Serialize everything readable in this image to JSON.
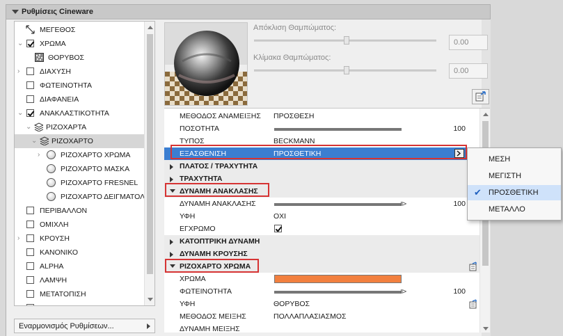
{
  "header": {
    "title": "Ρυθμίσεις Cineware"
  },
  "tree": {
    "items": [
      {
        "label": "ΜΕΓΕΘΟΣ"
      },
      {
        "label": "ΧΡΩΜΑ"
      },
      {
        "label": "ΘΟΡΥΒΟΣ"
      },
      {
        "label": "ΔΙΑΧΥΣΗ"
      },
      {
        "label": "ΦΩΤΕΙΝΟΤΗΤΑ"
      },
      {
        "label": "ΔΙΑΦΑΝΕΙΑ"
      },
      {
        "label": "ΑΝΑΚΛΑΣΤΙΚΟΤΗΤΑ"
      },
      {
        "label": "ΡΙΖΟΧΑΡΤΑ"
      },
      {
        "label": "ΡΙΖΟΧΑΡΤΟ"
      },
      {
        "label": "ΡΙΖΟΧΑΡΤΟ ΧΡΩΜΑ"
      },
      {
        "label": "ΡΙΖΟΧΑΡΤΟ ΜΑΣΚΑ"
      },
      {
        "label": "ΡΙΖΟΧΑΡΤΟ FRESNEL"
      },
      {
        "label": "ΡΙΖΟΧΑΡΤΟ ΔΕΙΓΜΑΤΟΛ"
      },
      {
        "label": "ΠΕΡΙΒΑΛΛΟΝ"
      },
      {
        "label": "ΟΜΙΧΛΗ"
      },
      {
        "label": "ΚΡΟΥΣΗ"
      },
      {
        "label": "ΚΑΝΟΝΙΚΟ"
      },
      {
        "label": "ALPHA"
      },
      {
        "label": "ΛΑΜΨΗ"
      },
      {
        "label": "ΜΕΤΑΤΟΠΙΣΗ"
      }
    ]
  },
  "footer": {
    "label": "Εναρμονισμός Ρυθμίσεων..."
  },
  "blur": {
    "deviation_label": "Απόκλιση Θαμπώματος:",
    "deviation_value": "0.00",
    "scale_label": "Κλίμακα Θαμπώματος:",
    "scale_value": "0.00"
  },
  "props": {
    "blend_mode": {
      "name": "ΜΕΘΟΔΟΣ ΑΝΑΜΕΙΞΗΣ",
      "value": "ΠΡΟΣΘΕΣΗ"
    },
    "amount": {
      "name": "ΠΟΣΟΤΗΤΑ",
      "value": "100",
      "level": 1.0
    },
    "type": {
      "name": "ΤΥΠΟΣ",
      "value": "BECKMANN"
    },
    "attenuation": {
      "name": "ΕΞΑΣΘΕΝΙΣΗ",
      "value": "ΠΡΟΣΘΕΤΙΚΗ"
    },
    "group_width_height": "ΠΛΑΤΟΣ / ΤΡΑΧΥΤΗΤΑ",
    "group_roughness": "ΤΡΑΧΥΤΗΤΑ",
    "group_reflection": "ΔΥΝΑΜΗ ΑΝΑΚΛΑΣΗΣ",
    "reflection_strength": {
      "name": "ΔΥΝΑΜΗ ΑΝΑΚΛΑΣΗΣ",
      "value": "100",
      "level": 1.0
    },
    "texture": {
      "name": "ΥΦΗ",
      "value": "ΟΧΙ"
    },
    "colored": {
      "name": "ΕΓΧΡΩΜΟ"
    },
    "group_specular": "ΚΑΤΟΠΤΡΙΚΗ ΔΥΝΑΜΗ",
    "group_bump": "ΔΥΝΑΜΗ ΚΡΟΥΣΗΣ",
    "group_layer_color": "ΡΙΖΟΧΑΡΤΟ ΧΡΩΜΑ",
    "color": {
      "name": "ΧΡΩΜΑ",
      "swatch": "#f2803f"
    },
    "brightness": {
      "name": "ΦΩΤΕΙΝΟΤΗΤΑ",
      "value": "100",
      "level": 1.0
    },
    "texture2": {
      "name": "ΥΦΗ",
      "value": "ΘΟΡΥΒΟΣ"
    },
    "mix_mode": {
      "name": "ΜΕΘΟΔΟΣ ΜΕΙΞΗΣ",
      "value": "ΠΟΛΛΑΠΛΑΣΙΑΣΜΟΣ"
    },
    "mix_strength": {
      "name": "ΔΥΝΑΜΗ ΜΕΙΞΗΣ"
    }
  },
  "popup": {
    "options": [
      "ΜΕΣΗ",
      "ΜΕΓΙΣΤΗ",
      "ΠΡΟΣΘΕΤΙΚΗ",
      "ΜΕΤΑΛΛΟ"
    ],
    "selected": "ΠΡΟΣΘΕΤΙΚΗ"
  },
  "colors": {
    "highlight": "#3b7ed1",
    "annotation": "#d63333",
    "swatch": "#f2803f"
  }
}
